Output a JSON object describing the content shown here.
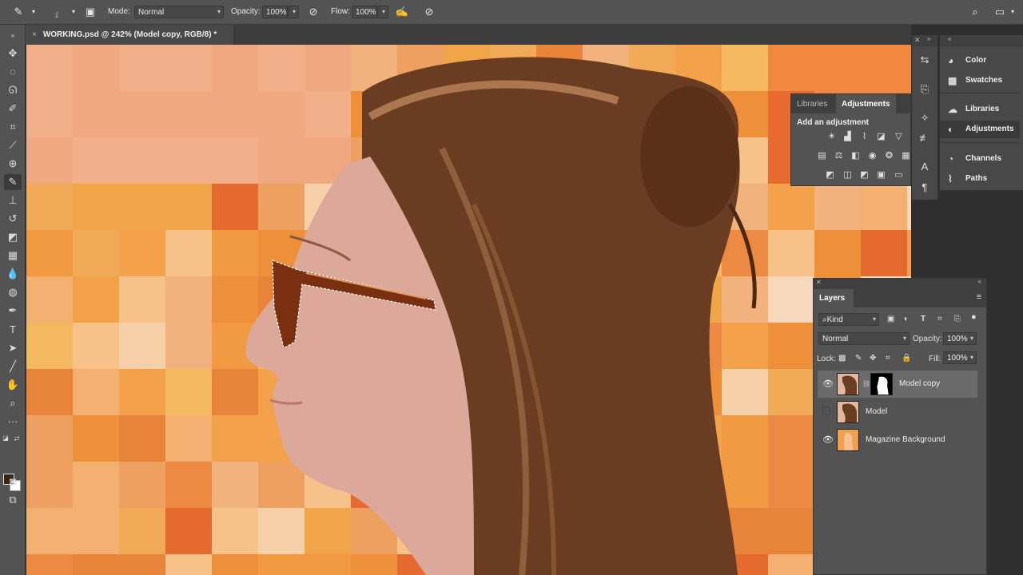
{
  "options_bar": {
    "brush_size": "1",
    "mode_label": "Mode:",
    "mode_value": "Normal",
    "opacity_label": "Opacity:",
    "opacity_value": "100%",
    "flow_label": "Flow:",
    "flow_value": "100%"
  },
  "document": {
    "tab_title": "WORKING.psd @ 242% (Model copy, RGB/8) *",
    "close_glyph": "×"
  },
  "colors": {
    "foreground": "#3a2518",
    "background": "#ffffff",
    "canvas_orange": "#f0a040"
  },
  "panel_dock": {
    "items": [
      {
        "label": "Color",
        "icon": "color-wheel-icon"
      },
      {
        "label": "Swatches",
        "icon": "grid-icon"
      },
      {
        "label": "Libraries",
        "icon": "cloud-icon"
      },
      {
        "label": "Adjustments",
        "icon": "half-circle-icon",
        "active": true
      },
      {
        "label": "Channels",
        "icon": "channels-icon"
      },
      {
        "label": "Paths",
        "icon": "paths-icon"
      }
    ]
  },
  "adjustments": {
    "tabs": [
      "Libraries",
      "Adjustments"
    ],
    "active_tab": "Adjustments",
    "title": "Add an adjustment"
  },
  "layers": {
    "tab": "Layers",
    "filter_value": "Kind",
    "blend_mode": "Normal",
    "opacity_label": "Opacity:",
    "opacity_value": "100%",
    "lock_label": "Lock:",
    "fill_label": "Fill:",
    "fill_value": "100%",
    "rows": [
      {
        "name": "Model copy",
        "visible": true,
        "selected": true,
        "has_mask": true
      },
      {
        "name": "Model",
        "visible": false,
        "selected": false,
        "has_mask": false
      },
      {
        "name": "Magazine Background",
        "visible": true,
        "selected": false,
        "has_mask": false
      }
    ]
  }
}
